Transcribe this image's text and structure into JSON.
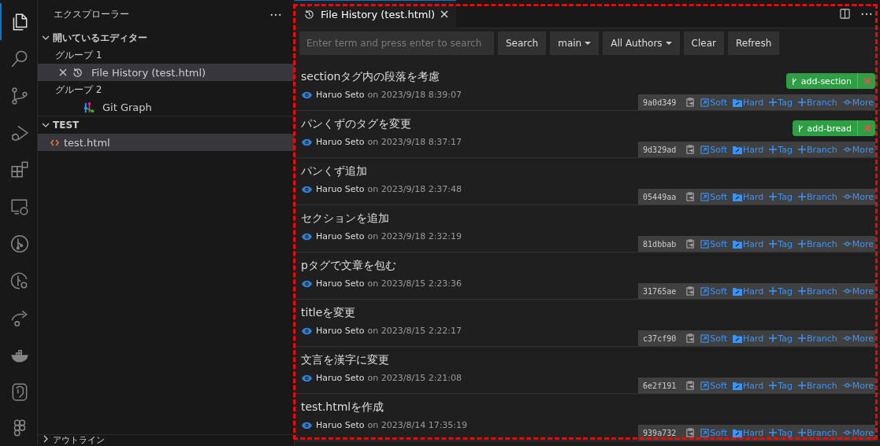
{
  "activity_bar": {
    "items": [
      {
        "kind": "explorer",
        "selected": true
      },
      {
        "kind": "search",
        "selected": false
      },
      {
        "kind": "source-control",
        "selected": false
      },
      {
        "kind": "debug",
        "selected": false
      },
      {
        "kind": "extensions",
        "selected": false
      },
      {
        "kind": "remote",
        "selected": false
      },
      {
        "kind": "git-graph",
        "selected": false
      },
      {
        "kind": "git-history",
        "selected": false
      },
      {
        "kind": "share",
        "selected": false
      },
      {
        "kind": "docker",
        "selected": false
      },
      {
        "kind": "database",
        "selected": false
      },
      {
        "kind": "design",
        "selected": false
      }
    ]
  },
  "sidebar": {
    "title": "エクスプローラー",
    "open_editors": {
      "label": "開いているエディター",
      "expanded": true,
      "groups": [
        {
          "label": "グループ 1",
          "items": [
            {
              "label": "File History (test.html)",
              "kind": "history",
              "selected": true
            }
          ]
        },
        {
          "label": "グループ 2",
          "items": [
            {
              "label": "Git Graph",
              "kind": "git-graph",
              "selected": false
            }
          ]
        }
      ]
    },
    "workspace": {
      "label": "TEST",
      "expanded": true,
      "files": [
        {
          "label": "test.html",
          "selected": true
        }
      ]
    },
    "outline": {
      "label": "アウトライン",
      "expanded": false
    }
  },
  "editor": {
    "tab": {
      "label": "File History (test.html)",
      "selected": true
    },
    "search": {
      "placeholder": "Enter term and press enter to search"
    },
    "buttons": [
      {
        "label": "Search",
        "dropdown": false
      },
      {
        "label": "main",
        "dropdown": true
      },
      {
        "label": "All Authors",
        "dropdown": true
      },
      {
        "label": "Clear",
        "dropdown": false
      },
      {
        "label": "Refresh",
        "dropdown": false
      }
    ],
    "commits": [
      {
        "message": "sectionタグ内の段落を考慮",
        "author": "Haruo Seto",
        "date": "on 2023/9/18 8:39:07",
        "hash": "9a0d349",
        "branch": "add-section",
        "actions": [
          {
            "kind": "soft",
            "label": "Soft"
          },
          {
            "kind": "hard",
            "label": "Hard"
          },
          {
            "kind": "tag",
            "label": "Tag"
          },
          {
            "kind": "branch",
            "label": "Branch"
          },
          {
            "kind": "more",
            "label": "More"
          }
        ]
      },
      {
        "message": "パンくずのタグを変更",
        "author": "Haruo Seto",
        "date": "on 2023/9/18 8:37:17",
        "hash": "9d329ad",
        "branch": "add-bread",
        "actions": [
          {
            "kind": "soft",
            "label": "Soft"
          },
          {
            "kind": "hard",
            "label": "Hard"
          },
          {
            "kind": "tag",
            "label": "Tag"
          },
          {
            "kind": "branch",
            "label": "Branch"
          },
          {
            "kind": "more",
            "label": "More"
          }
        ]
      },
      {
        "message": "パンくず追加",
        "author": "Haruo Seto",
        "date": "on 2023/9/18 2:37:48",
        "hash": "05449aa",
        "actions": [
          {
            "kind": "soft",
            "label": "Soft"
          },
          {
            "kind": "hard",
            "label": "Hard"
          },
          {
            "kind": "tag",
            "label": "Tag"
          },
          {
            "kind": "branch",
            "label": "Branch"
          },
          {
            "kind": "more",
            "label": "More"
          }
        ]
      },
      {
        "message": "セクションを追加",
        "author": "Haruo Seto",
        "date": "on 2023/9/18 2:32:19",
        "hash": "81dbbab",
        "actions": [
          {
            "kind": "soft",
            "label": "Soft"
          },
          {
            "kind": "hard",
            "label": "Hard"
          },
          {
            "kind": "tag",
            "label": "Tag"
          },
          {
            "kind": "branch",
            "label": "Branch"
          },
          {
            "kind": "more",
            "label": "More"
          }
        ]
      },
      {
        "message": "pタグで文章を包む",
        "author": "Haruo Seto",
        "date": "on 2023/8/15 2:23:36",
        "hash": "31765ae",
        "actions": [
          {
            "kind": "soft",
            "label": "Soft"
          },
          {
            "kind": "hard",
            "label": "Hard"
          },
          {
            "kind": "tag",
            "label": "Tag"
          },
          {
            "kind": "branch",
            "label": "Branch"
          },
          {
            "kind": "more",
            "label": "More"
          }
        ]
      },
      {
        "message": "titleを変更",
        "author": "Haruo Seto",
        "date": "on 2023/8/15 2:22:17",
        "hash": "c37cf90",
        "actions": [
          {
            "kind": "soft",
            "label": "Soft"
          },
          {
            "kind": "hard",
            "label": "Hard"
          },
          {
            "kind": "tag",
            "label": "Tag"
          },
          {
            "kind": "branch",
            "label": "Branch"
          },
          {
            "kind": "more",
            "label": "More"
          }
        ]
      },
      {
        "message": "文言を漢字に変更",
        "author": "Haruo Seto",
        "date": "on 2023/8/15 2:21:08",
        "hash": "6e2f191",
        "actions": [
          {
            "kind": "soft",
            "label": "Soft"
          },
          {
            "kind": "hard",
            "label": "Hard"
          },
          {
            "kind": "tag",
            "label": "Tag"
          },
          {
            "kind": "branch",
            "label": "Branch"
          },
          {
            "kind": "more",
            "label": "More"
          }
        ]
      },
      {
        "message": "test.htmlを作成",
        "author": "Haruo Seto",
        "date": "on 2023/8/14 17:35:19",
        "hash": "939a732",
        "actions": [
          {
            "kind": "soft",
            "label": "Soft"
          },
          {
            "kind": "hard",
            "label": "Hard"
          },
          {
            "kind": "tag",
            "label": "Tag"
          },
          {
            "kind": "branch",
            "label": "Branch"
          },
          {
            "kind": "more",
            "label": "More"
          }
        ]
      }
    ]
  }
}
